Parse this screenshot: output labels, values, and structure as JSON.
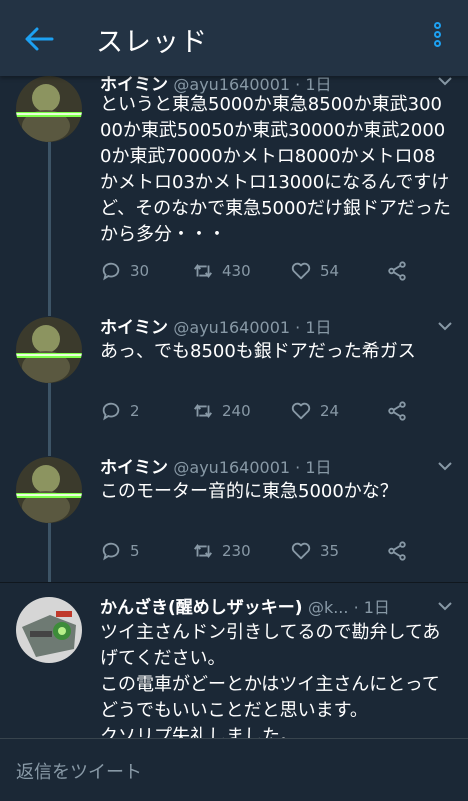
{
  "header": {
    "title": "スレッド"
  },
  "tweets": [
    {
      "name": "ホイミン",
      "meta": "@ayu1640001 · 1日",
      "body": "というと東急5000か東急8500か東武30000か東武50050か東武30000か東武20000か東武70000かメトロ8000かメトロ08かメトロ03かメトロ13000になるんですけど、そのなかで東急5000だけ銀ドアだったから多分・・・",
      "replies": "30",
      "retweets": "430",
      "likes": "54"
    },
    {
      "name": "ホイミン",
      "meta": "@ayu1640001 · 1日",
      "body": "あっ、でも8500も銀ドアだった希ガス",
      "replies": "2",
      "retweets": "240",
      "likes": "24"
    },
    {
      "name": "ホイミン",
      "meta": "@ayu1640001 · 1日",
      "body": "このモーター音的に東急5000かな？",
      "replies": "5",
      "retweets": "230",
      "likes": "35"
    },
    {
      "name": "かんざき(醒めしザッキー)",
      "meta": "@k... · 1日",
      "body": "ツイ主さんドン引きしてるので勘弁してあげてください。\nこの電車がどーとかはツイ主さんにとってどうでもいいことだと思います。\nクソリプ失礼しました。"
    }
  ],
  "reply": {
    "placeholder": "返信をツイート"
  },
  "colors": {
    "accent": "#1da1f2",
    "background": "#1b2836",
    "secondary_text": "#8899a6"
  }
}
